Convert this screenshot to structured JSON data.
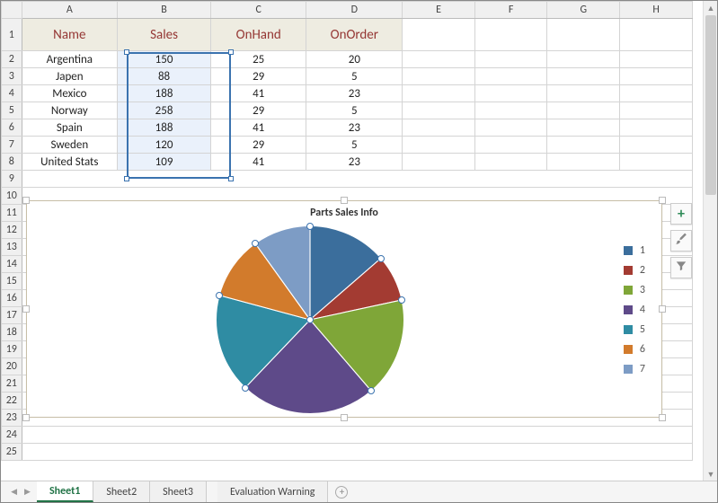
{
  "columns": [
    "A",
    "B",
    "C",
    "D",
    "E",
    "F",
    "G",
    "H"
  ],
  "rows": [
    "1",
    "2",
    "3",
    "4",
    "5",
    "6",
    "7",
    "8",
    "9",
    "10",
    "11",
    "12",
    "13",
    "14",
    "15",
    "16",
    "17",
    "18",
    "19",
    "20",
    "21",
    "22",
    "23",
    "24",
    "25"
  ],
  "headers": {
    "a": "Name",
    "b": "Sales",
    "c": "OnHand",
    "d": "OnOrder"
  },
  "table": [
    {
      "name": "Argentina",
      "sales": "150",
      "onhand": "25",
      "onorder": "20"
    },
    {
      "name": "Japen",
      "sales": "88",
      "onhand": "29",
      "onorder": "5"
    },
    {
      "name": "Mexico",
      "sales": "188",
      "onhand": "41",
      "onorder": "23"
    },
    {
      "name": "Norway",
      "sales": "258",
      "onhand": "29",
      "onorder": "5"
    },
    {
      "name": "Spain",
      "sales": "188",
      "onhand": "41",
      "onorder": "23"
    },
    {
      "name": "Sweden",
      "sales": "120",
      "onhand": "29",
      "onorder": "5"
    },
    {
      "name": "United Stats",
      "sales": "109",
      "onhand": "41",
      "onorder": "23"
    }
  ],
  "chart": {
    "title": "Parts Sales Info",
    "legend": [
      "1",
      "2",
      "3",
      "4",
      "5",
      "6",
      "7"
    ]
  },
  "tabs": [
    "Sheet1",
    "Sheet2",
    "Sheet3",
    "Evaluation Warning"
  ],
  "active_tab": "Sheet1",
  "chart_data": {
    "type": "pie",
    "title": "Parts Sales Info",
    "categories": [
      "Argentina",
      "Japen",
      "Mexico",
      "Norway",
      "Spain",
      "Sweden",
      "United Stats"
    ],
    "values": [
      150,
      88,
      188,
      258,
      188,
      120,
      109
    ],
    "colors": [
      "#3b6e9c",
      "#a33b32",
      "#7fa638",
      "#5e4a89",
      "#2f8ca3",
      "#d27b2c",
      "#7d9cc5"
    ],
    "legend_labels": [
      "1",
      "2",
      "3",
      "4",
      "5",
      "6",
      "7"
    ],
    "legend_position": "right"
  }
}
